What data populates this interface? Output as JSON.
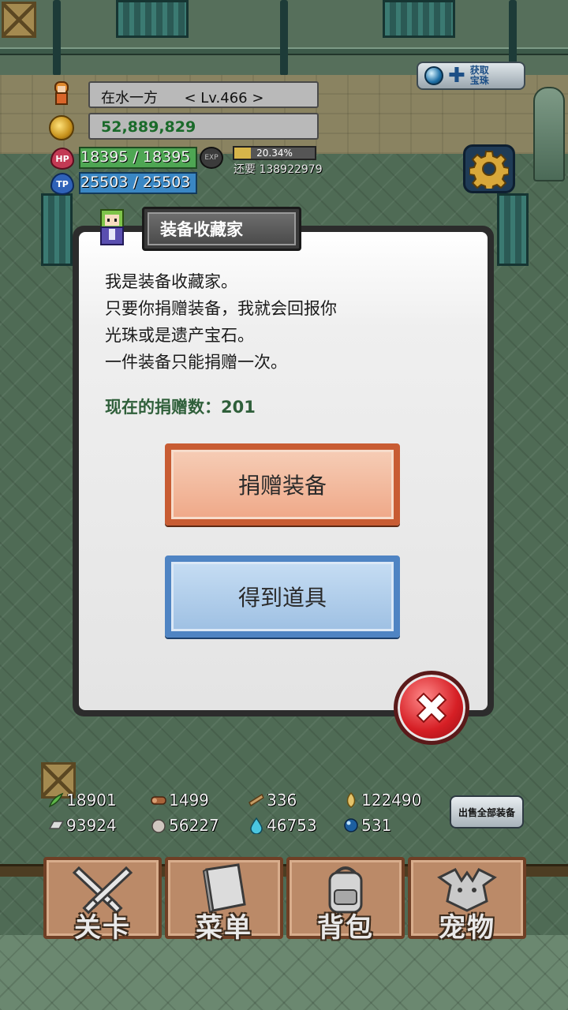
{
  "player": {
    "name": "在水一方",
    "level": "< Lv.466 >",
    "gold": "52,889,829",
    "hp": "18395 / 18395",
    "tp": "25503 / 25503",
    "hp_icon": "HP",
    "tp_icon": "TP",
    "exp_icon": "EXP",
    "exp_percent": "20.34%",
    "exp_fraction": 0.2034,
    "exp_needed": "还要 138922979"
  },
  "top_right": {
    "gem_label_1": "获取",
    "gem_label_2": "宝珠"
  },
  "dialog": {
    "title": "装备收藏家",
    "lines": [
      "我是装备收藏家。",
      "只要你捐赠装备，我就会回报你",
      "光珠或是遗产宝石。",
      "一件装备只能捐赠一次。"
    ],
    "donation_count": "现在的捐赠数：201",
    "donate_button": "捐赠装备",
    "get_button": "得到道具"
  },
  "resources": {
    "herb": "18901",
    "wood": "1499",
    "plank": "336",
    "seed": "122490",
    "ore": "93924",
    "stone": "56227",
    "water": "46753",
    "orb": "531"
  },
  "sell_all_label": "出售全部装备",
  "nav": {
    "stage": "关卡",
    "menu": "菜单",
    "bag": "背包",
    "pet": "宠物"
  },
  "colors": {
    "hp": "#4ea653",
    "tp": "#3a87c4",
    "donate_border": "#c85c33",
    "get_border": "#4f84c3",
    "close": "#d61f25"
  }
}
